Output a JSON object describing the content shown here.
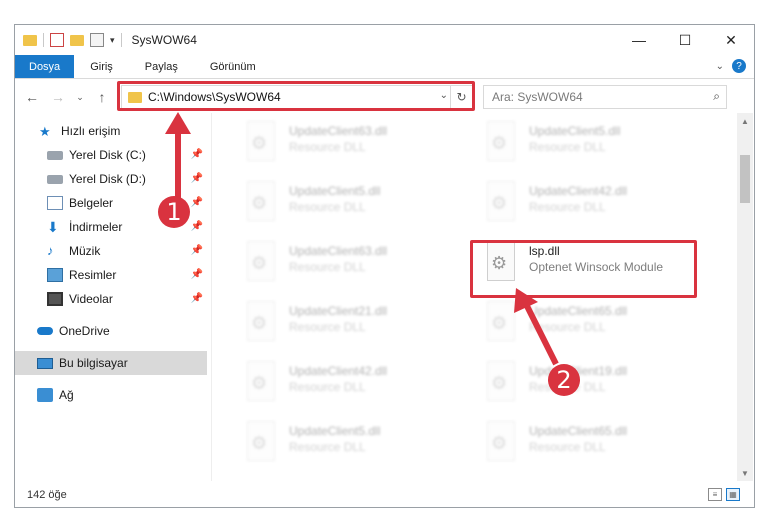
{
  "window": {
    "title": "SysWOW64",
    "controls": {
      "minimize": "—",
      "maximize": "☐",
      "close": "✕"
    }
  },
  "ribbon": {
    "tabs": [
      "Dosya",
      "Giriş",
      "Paylaş",
      "Görünüm"
    ],
    "expand_icon": "chevron-down-icon",
    "help": "?"
  },
  "navbar": {
    "address": "C:\\Windows\\SysWOW64",
    "search_placeholder": "Ara: SysWOW64"
  },
  "sidebar": {
    "quick_access": "Hızlı erişim",
    "pinned": [
      {
        "label": "Yerel Disk (C:)",
        "icon": "drive-icon"
      },
      {
        "label": "Yerel Disk (D:)",
        "icon": "drive-icon"
      },
      {
        "label": "Belgeler",
        "icon": "documents-icon"
      },
      {
        "label": "İndirmeler",
        "icon": "download-icon"
      },
      {
        "label": "Müzik",
        "icon": "music-icon"
      },
      {
        "label": "Resimler",
        "icon": "pictures-icon"
      },
      {
        "label": "Videolar",
        "icon": "videos-icon"
      }
    ],
    "onedrive": "OneDrive",
    "this_pc": "Bu bilgisayar",
    "network": "Ağ"
  },
  "files": [
    {
      "name": "UpdateClient63.dll",
      "type": "Resource DLL",
      "faded": true
    },
    {
      "name": "UpdateClient5.dll",
      "type": "Resource DLL",
      "faded": true
    },
    {
      "name": "UpdateClient5.dll",
      "type": "Resource DLL",
      "faded": true
    },
    {
      "name": "UpdateClient42.dll",
      "type": "Resource DLL",
      "faded": true
    },
    {
      "name": "UpdateClient63.dll",
      "type": "Resource DLL",
      "faded": true
    },
    {
      "name": "lsp.dll",
      "type": "Optenet Winsock Module",
      "faded": false
    },
    {
      "name": "UpdateClient21.dll",
      "type": "Resource DLL",
      "faded": true
    },
    {
      "name": "UpdateClient65.dll",
      "type": "Resource DLL",
      "faded": true
    },
    {
      "name": "UpdateClient42.dll",
      "type": "Resource DLL",
      "faded": true
    },
    {
      "name": "UpdateClient19.dll",
      "type": "Resource DLL",
      "faded": true
    },
    {
      "name": "UpdateClient5.dll",
      "type": "Resource DLL",
      "faded": true
    },
    {
      "name": "UpdateClient65.dll",
      "type": "Resource DLL",
      "faded": true
    }
  ],
  "status": {
    "count": "142 öğe"
  },
  "annotations": {
    "step1": "1",
    "step2": "2",
    "color": "#d9333f"
  }
}
